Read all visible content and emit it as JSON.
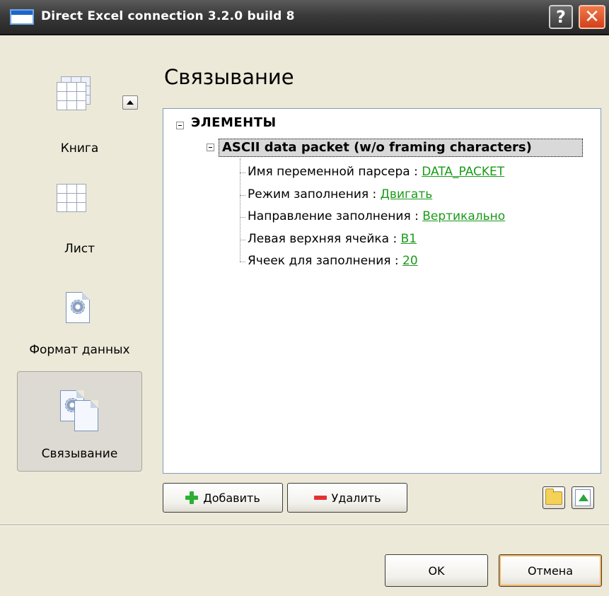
{
  "window": {
    "title": "Direct Excel connection 3.2.0 build 8",
    "help_glyph": "?",
    "close_glyph": "✕"
  },
  "nav": {
    "items": [
      {
        "label": "Книга",
        "icon": "workbook-grid-icon"
      },
      {
        "label": "Лист",
        "icon": "sheet-grid-icon"
      },
      {
        "label": "Формат данных",
        "icon": "document-gear-icon"
      },
      {
        "label": "Связывание",
        "icon": "linked-documents-icon",
        "selected": true
      }
    ]
  },
  "main": {
    "title": "Связывание",
    "tree": {
      "root": {
        "label": "ЭЛЕМЕНТЫ",
        "expanded": true
      },
      "packet": {
        "label": "ASCII data packet (w/o framing characters)",
        "expanded": true,
        "selected": true
      },
      "props": [
        {
          "name": "Имя переменной парсера : ",
          "value": "DATA_PACKET"
        },
        {
          "name": "Режим заполнения : ",
          "value": "Двигать"
        },
        {
          "name": "Направление заполнения : ",
          "value": "Вертикально"
        },
        {
          "name": "Левая верхняя ячейка : ",
          "value": "B1"
        },
        {
          "name": "Ячеек для заполнения : ",
          "value": "20"
        }
      ]
    },
    "buttons": {
      "add": "Добавить",
      "delete": "Удалить"
    }
  },
  "footer": {
    "ok": "OK",
    "cancel": "Отмена"
  },
  "colors": {
    "link_value": "#1a9a1a",
    "selection": "#d9d9d9",
    "title_bar": "#3a3a3a",
    "close_button": "#d4401a"
  }
}
